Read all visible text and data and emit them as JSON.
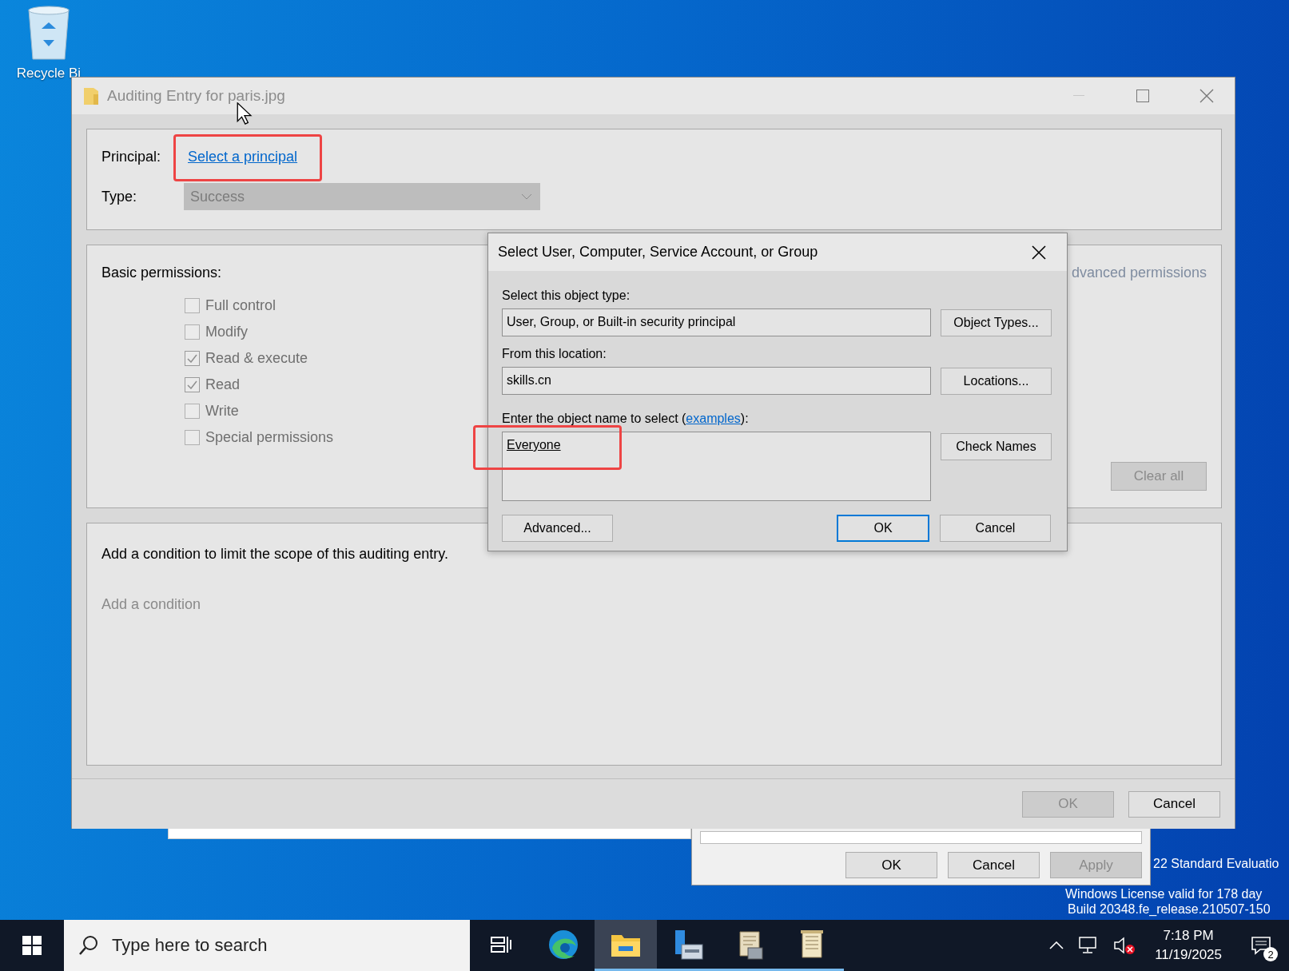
{
  "desktop": {
    "icons": [
      {
        "label": "Recycle Bi"
      }
    ]
  },
  "properties_window": {
    "buttons": [
      {
        "label": "OK",
        "disabled": false
      },
      {
        "label": "Cancel",
        "disabled": false
      },
      {
        "label": "Apply",
        "disabled": true
      }
    ]
  },
  "auditing_window": {
    "title": "Auditing Entry for paris.jpg",
    "principal_label": "Principal:",
    "principal_link": "Select a principal",
    "type_label": "Type:",
    "type_value": "Success",
    "permissions_heading": "Basic permissions:",
    "permissions": [
      {
        "label": "Full control",
        "checked": false
      },
      {
        "label": "Modify",
        "checked": false
      },
      {
        "label": "Read & execute",
        "checked": true
      },
      {
        "label": "Read",
        "checked": true
      },
      {
        "label": "Write",
        "checked": false
      },
      {
        "label": "Special permissions",
        "checked": false
      }
    ],
    "advanced_link": "dvanced permissions",
    "clear_all": "Clear all",
    "condition_text": "Add a condition to limit the scope of this auditing entry.",
    "add_condition": "Add a condition",
    "buttons": [
      {
        "label": "OK",
        "disabled": true
      },
      {
        "label": "Cancel",
        "disabled": false
      }
    ]
  },
  "select_dialog": {
    "title": "Select User, Computer, Service Account, or Group",
    "object_type_label": "Select this object type:",
    "object_type_value": "User, Group, or Built-in security principal",
    "object_types_button": "Object Types...",
    "location_label": "From this location:",
    "location_value": "skills.cn",
    "locations_button": "Locations...",
    "name_label_before": "Enter the object name to select (",
    "name_label_link": "examples",
    "name_label_after": "):",
    "name_value": "Everyone",
    "check_names_button": "Check Names",
    "buttons": [
      {
        "label": "Advanced...",
        "default": false
      },
      {
        "label": "OK",
        "default": true
      },
      {
        "label": "Cancel",
        "default": false
      }
    ]
  },
  "edition_notice": [
    "22 Standard Evaluatio",
    "Windows License valid for 178 day",
    "Build 20348.fe_release.210507-150"
  ],
  "taskbar": {
    "search_placeholder": "Type here to search",
    "apps": [
      {
        "kind": "task-view",
        "running": false,
        "selected": false
      },
      {
        "kind": "browser",
        "running": false,
        "selected": false
      },
      {
        "kind": "folder",
        "running": true,
        "selected": true
      },
      {
        "kind": "server",
        "running": true,
        "selected": false
      },
      {
        "kind": "scroll",
        "running": true,
        "selected": false
      },
      {
        "kind": "notepad",
        "running": true,
        "selected": false
      }
    ],
    "time": "7:18 PM",
    "date": "11/19/2025",
    "notification_count": "2"
  }
}
